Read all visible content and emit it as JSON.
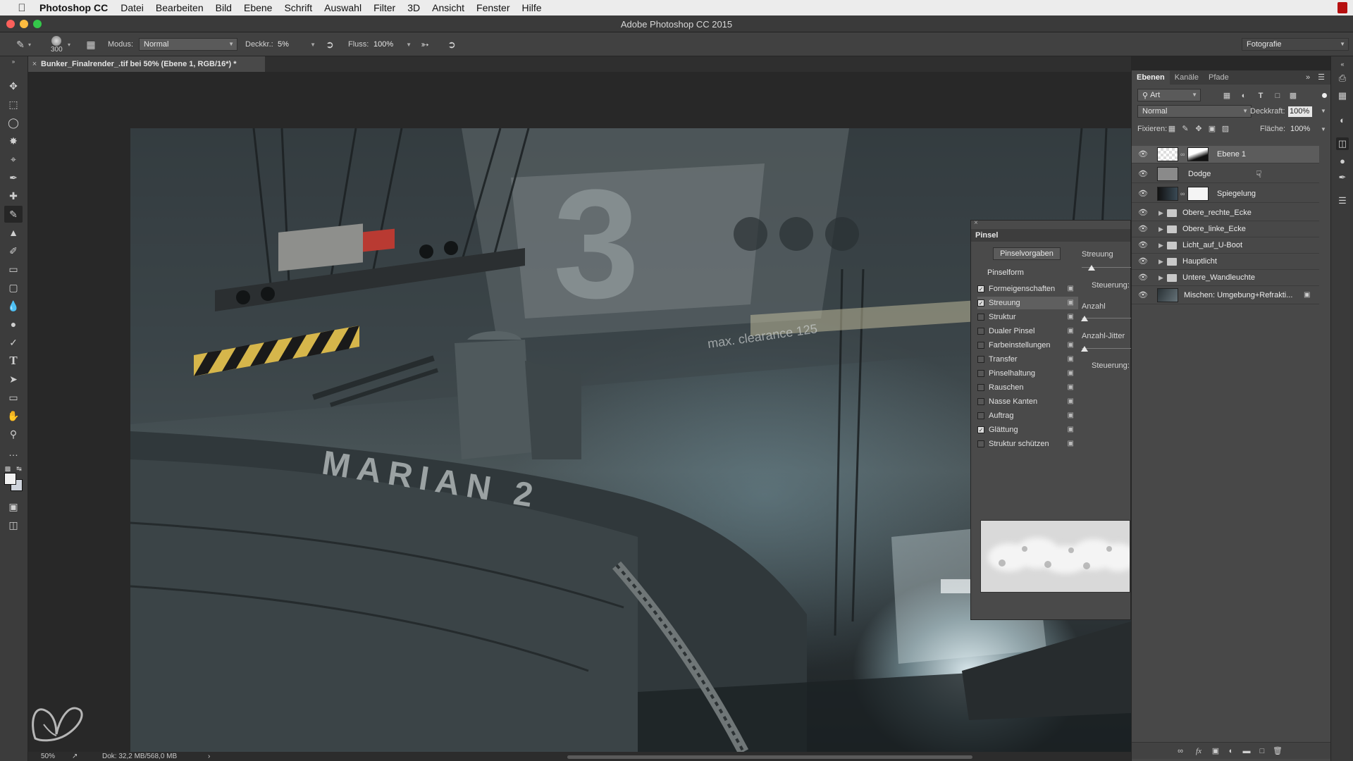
{
  "menubar": {
    "app_name": "Photoshop CC",
    "items": [
      "Datei",
      "Bearbeiten",
      "Bild",
      "Ebene",
      "Schrift",
      "Auswahl",
      "Filter",
      "3D",
      "Ansicht",
      "Fenster",
      "Hilfe"
    ]
  },
  "window": {
    "title": "Adobe Photoshop CC 2015"
  },
  "options": {
    "brush_size": "300",
    "mode_label": "Modus:",
    "mode_value": "Normal",
    "opacity_label": "Deckkr.:",
    "opacity_value": "5%",
    "flow_label": "Fluss:",
    "flow_value": "100%",
    "workspace": "Fotografie"
  },
  "document": {
    "tab_title": "Bunker_Finalrender_.tif bei 50% (Ebene 1, RGB/16*) *"
  },
  "artwork": {
    "ship_name": "MARIAN 2",
    "hangar_number": "3",
    "wall_sign": "max. clearance 125"
  },
  "status": {
    "zoom": "50%",
    "doc_info": "Dok: 32,2 MB/568,0 MB"
  },
  "brush_panel": {
    "title": "Pinsel",
    "presets_button": "Pinselvorgaben",
    "brush_shape": "Pinselform",
    "options": [
      {
        "label": "Formeigenschaften",
        "checked": true
      },
      {
        "label": "Streuung",
        "checked": true
      },
      {
        "label": "Struktur",
        "checked": false
      },
      {
        "label": "Dualer Pinsel",
        "checked": false
      },
      {
        "label": "Farbeinstellungen",
        "checked": false
      },
      {
        "label": "Transfer",
        "checked": false
      },
      {
        "label": "Pinselhaltung",
        "checked": false
      },
      {
        "label": "Rauschen",
        "checked": false
      },
      {
        "label": "Nasse Kanten",
        "checked": false
      },
      {
        "label": "Auftrag",
        "checked": false
      },
      {
        "label": "Glättung",
        "checked": true
      },
      {
        "label": "Struktur schützen",
        "checked": false
      }
    ],
    "right": {
      "scatter": "Streuung",
      "control1": "Steuerung:",
      "count": "Anzahl",
      "count_jitter": "Anzahl-Jitter",
      "control2": "Steuerung:"
    }
  },
  "layers_panel": {
    "tabs": [
      "Ebenen",
      "Kanäle",
      "Pfade"
    ],
    "filter_kind": "Art",
    "blend_mode": "Normal",
    "opacity_label": "Deckkraft:",
    "opacity_value": "100%",
    "lock_label": "Fixieren:",
    "fill_label": "Fläche:",
    "fill_value": "100%",
    "layers": [
      {
        "name": "Ebene 1",
        "type": "layer-mask"
      },
      {
        "name": "Dodge",
        "type": "layer"
      },
      {
        "name": "Spiegelung",
        "type": "layer-mask"
      },
      {
        "name": "Obere_rechte_Ecke",
        "type": "group"
      },
      {
        "name": "Obere_linke_Ecke",
        "type": "group"
      },
      {
        "name": "Licht_auf_U-Boot",
        "type": "group"
      },
      {
        "name": "Hauptlicht",
        "type": "group"
      },
      {
        "name": "Untere_Wandleuchte",
        "type": "group"
      },
      {
        "name": "Mischen: Umgebung+Refrakti...",
        "type": "locked"
      }
    ]
  }
}
